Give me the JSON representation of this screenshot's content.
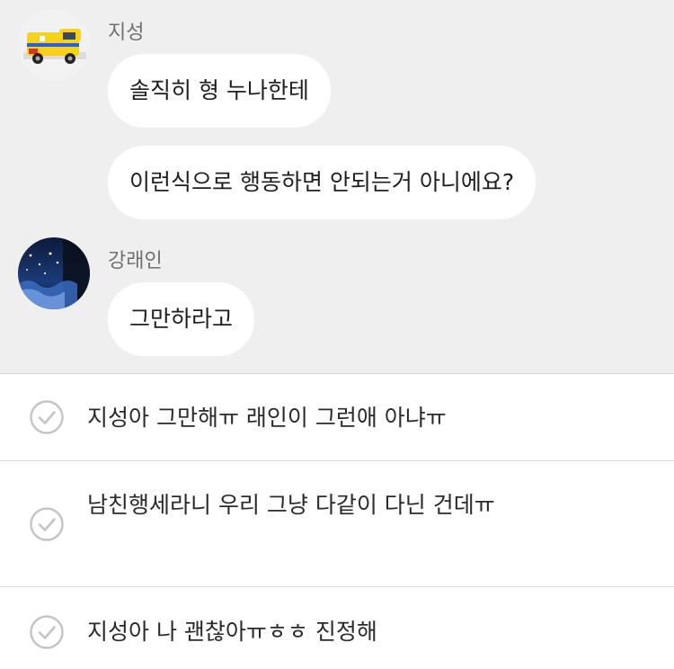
{
  "messages": [
    {
      "sender": "지성",
      "lines": [
        "솔직히 형 누나한테",
        "이런식으로 행동하면 안되는거 아니에요?"
      ]
    },
    {
      "sender": "강래인",
      "lines": [
        "그만하라고"
      ]
    }
  ],
  "choices": [
    {
      "text": "지성아 그만해ㅠ 래인이 그런애 아냐ㅠ"
    },
    {
      "text": "남친행세라니 우리 그냥 다같이 다닌 건데ㅠ"
    },
    {
      "text": "지성아 나 괜찮아ㅠㅎㅎ 진정해"
    }
  ],
  "icons": {
    "avatar_1": "ambulance-toy-avatar",
    "avatar_2": "night-ocean-avatar",
    "choice": "check-circle-icon"
  }
}
